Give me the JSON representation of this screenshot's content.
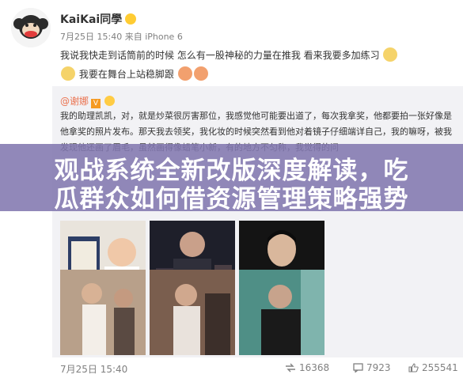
{
  "post": {
    "username": "KaiKai同學",
    "date": "7月25日 15:40",
    "source": "来自 iPhone 6",
    "text_line1": "我说我快走到话筒前的时候 怎么有一股神秘的力量在推我 看来我要多加练习",
    "text_line2": "我要在舞台上站稳脚跟"
  },
  "repost": {
    "author": "@谢娜",
    "v_badge": "V",
    "text": "我的助理凯凯，对，就是炒菜很厉害那位，我感觉他可能要出道了，每次我拿奖，他都要拍一张好像是他拿奖的照片发布。那天我去领奖，我化妆的时候突然看到他对着镜子仔细端详自己，我的嘛呀，被我发现他还画了眉毛，虽然画得像蜡笔小新，有的地方不匀称，我觉得的问"
  },
  "banner": {
    "line1": "观战系统全新改版深度解读，吃",
    "line2": "瓜群众如何借资源管理策略强势"
  },
  "footer": {
    "date": "7月25日 15:40",
    "reposts": "16368",
    "comments": "7923",
    "likes": "255541"
  },
  "icons": {
    "avatar": "monkey-avatar-icon",
    "repost": "repost-icon",
    "comment": "comment-icon",
    "like": "like-icon"
  }
}
